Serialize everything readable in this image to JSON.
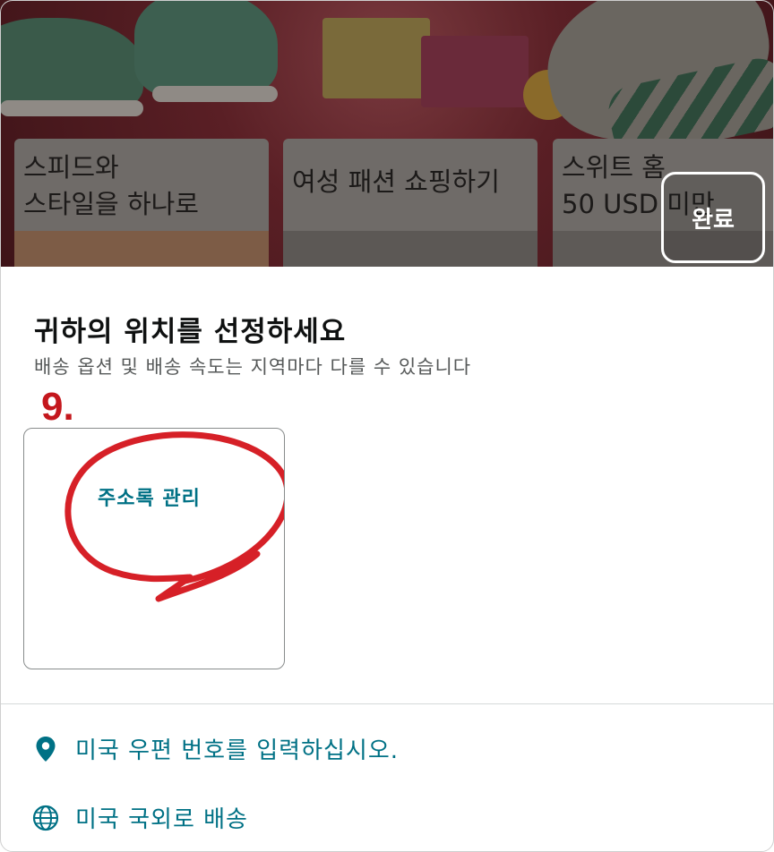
{
  "hero": {
    "cards": [
      {
        "line1": "스피드와",
        "line2": "스타일을 하나로"
      },
      {
        "line1": "여성 패션 쇼핑하기",
        "line2": ""
      },
      {
        "line1": "스위트 홈",
        "line2": "50 USD 미만"
      }
    ],
    "done_label": "완료"
  },
  "panel": {
    "title": "귀하의 위치를 선정하세요",
    "subtitle": "배송 옵션 및 배송 속도는 지역마다 다를 수 있습니다",
    "step_marker": "9.",
    "address_book_label": "주소록 관리",
    "options": [
      {
        "label": "미국 우편 번호를 입력하십시오.",
        "icon": "location-pin-icon"
      },
      {
        "label": "미국 국외로 배송",
        "icon": "globe-icon"
      }
    ]
  },
  "colors": {
    "link": "#007185",
    "annotation_red": "#d4141b",
    "title": "#0f1111"
  }
}
